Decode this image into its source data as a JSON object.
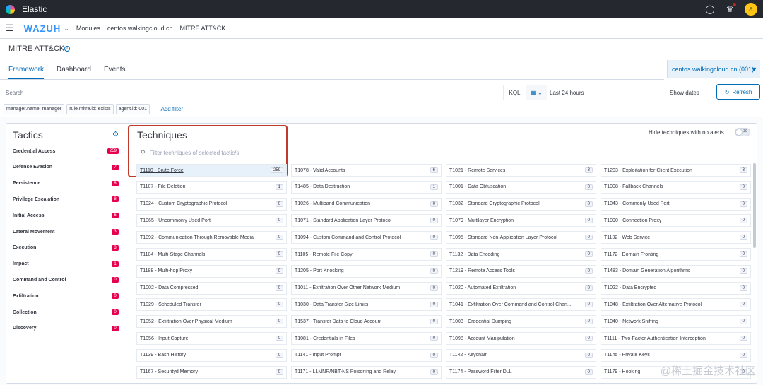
{
  "topbar": {
    "brand": "Elastic",
    "avatar_letter": "a",
    "icons": [
      "elastic-logo-icon",
      "help-icon",
      "news-icon"
    ]
  },
  "header": {
    "logo": "WAZUH",
    "breadcrumbs": [
      "Modules",
      "centos.walkingcloud.cn",
      "MITRE ATT&CK"
    ]
  },
  "page": {
    "title": "MITRE ATT&CK",
    "tabs": [
      {
        "label": "Framework",
        "active": true
      },
      {
        "label": "Dashboard",
        "active": false
      },
      {
        "label": "Events",
        "active": false
      }
    ],
    "agent": "centos.walkingcloud.cn (001)"
  },
  "search": {
    "placeholder": "Search",
    "kql": "KQL",
    "date_range": "Last 24 hours",
    "show_dates": "Show dates",
    "refresh": "Refresh"
  },
  "filters": {
    "pills": [
      "manager.name: manager",
      "rule.mitre.id: exists",
      "agent.id: 001"
    ],
    "add_filter": "+ Add filter"
  },
  "tactics": {
    "title": "Tactics",
    "items": [
      {
        "label": "Credential Access",
        "count": "259"
      },
      {
        "label": "Defense Evasion",
        "count": "7"
      },
      {
        "label": "Persistence",
        "count": "8"
      },
      {
        "label": "Privilege Escalation",
        "count": "8"
      },
      {
        "label": "Initial Access",
        "count": "6"
      },
      {
        "label": "Lateral Movement",
        "count": "3"
      },
      {
        "label": "Execution",
        "count": "3"
      },
      {
        "label": "Impact",
        "count": "1"
      },
      {
        "label": "Command and Control",
        "count": "0"
      },
      {
        "label": "Exfiltration",
        "count": "0"
      },
      {
        "label": "Collection",
        "count": "0"
      },
      {
        "label": "Discovery",
        "count": "0"
      }
    ]
  },
  "techniques": {
    "title": "Techniques",
    "filter_placeholder": "Filter techniques of selected tactic/s",
    "hide_label": "Hide techniques with no alerts",
    "rows": [
      [
        [
          "T1110 - Brute Force",
          "259"
        ],
        [
          "T1078 - Valid Accounts",
          "6"
        ],
        [
          "T1021 - Remote Services",
          "3"
        ],
        [
          "T1203 - Exploitation for Client Execution",
          "3"
        ]
      ],
      [
        [
          "T1107 - File Deletion",
          "1"
        ],
        [
          "T1485 - Data Destruction",
          "1"
        ],
        [
          "T1001 - Data Obfuscation",
          "0"
        ],
        [
          "T1008 - Fallback Channels",
          "0"
        ]
      ],
      [
        [
          "T1024 - Custom Cryptographic Protocol",
          "0"
        ],
        [
          "T1026 - Multiband Communication",
          "0"
        ],
        [
          "T1032 - Standard Cryptographic Protocol",
          "0"
        ],
        [
          "T1043 - Commonly Used Port",
          "0"
        ]
      ],
      [
        [
          "T1065 - Uncommonly Used Port",
          "0"
        ],
        [
          "T1071 - Standard Application Layer Protocol",
          "0"
        ],
        [
          "T1079 - Multilayer Encryption",
          "0"
        ],
        [
          "T1090 - Connection Proxy",
          "0"
        ]
      ],
      [
        [
          "T1092 - Communication Through Removable Media",
          "0"
        ],
        [
          "T1094 - Custom Command and Control Protocol",
          "0"
        ],
        [
          "T1095 - Standard Non-Application Layer Protocol",
          "0"
        ],
        [
          "T1102 - Web Service",
          "0"
        ]
      ],
      [
        [
          "T1104 - Multi-Stage Channels",
          "0"
        ],
        [
          "T1105 - Remote File Copy",
          "0"
        ],
        [
          "T1132 - Data Encoding",
          "0"
        ],
        [
          "T1172 - Domain Fronting",
          "0"
        ]
      ],
      [
        [
          "T1188 - Multi-hop Proxy",
          "0"
        ],
        [
          "T1205 - Port Knocking",
          "0"
        ],
        [
          "T1219 - Remote Access Tools",
          "0"
        ],
        [
          "T1483 - Domain Generation Algorithms",
          "0"
        ]
      ],
      [
        [
          "T1002 - Data Compressed",
          "0"
        ],
        [
          "T1011 - Exfiltration Over Other Network Medium",
          "0"
        ],
        [
          "T1020 - Automated Exfiltration",
          "0"
        ],
        [
          "T1022 - Data Encrypted",
          "0"
        ]
      ],
      [
        [
          "T1029 - Scheduled Transfer",
          "0"
        ],
        [
          "T1030 - Data Transfer Size Limits",
          "0"
        ],
        [
          "T1041 - Exfiltration Over Command and Control Chan...",
          "0"
        ],
        [
          "T1048 - Exfiltration Over Alternative Protocol",
          "0"
        ]
      ],
      [
        [
          "T1052 - Exfiltration Over Physical Medium",
          "0"
        ],
        [
          "T1537 - Transfer Data to Cloud Account",
          "0"
        ],
        [
          "T1003 - Credential Dumping",
          "0"
        ],
        [
          "T1040 - Network Sniffing",
          "0"
        ]
      ],
      [
        [
          "T1056 - Input Capture",
          "0"
        ],
        [
          "T1081 - Credentials in Files",
          "0"
        ],
        [
          "T1098 - Account Manipulation",
          "0"
        ],
        [
          "T1111 - Two-Factor Authentication Interception",
          "0"
        ]
      ],
      [
        [
          "T1139 - Bash History",
          "0"
        ],
        [
          "T1141 - Input Prompt",
          "0"
        ],
        [
          "T1142 - Keychain",
          "0"
        ],
        [
          "T1145 - Private Keys",
          "0"
        ]
      ],
      [
        [
          "T1167 - Securityd Memory",
          "0"
        ],
        [
          "T1171 - LLMNR/NBT-NS Poisoning and Relay",
          "0"
        ],
        [
          "T1174 - Password Filter DLL",
          "0"
        ],
        [
          "T1179 - Hooking",
          "0"
        ]
      ]
    ]
  },
  "watermark": "@稀土掘金技术社区"
}
